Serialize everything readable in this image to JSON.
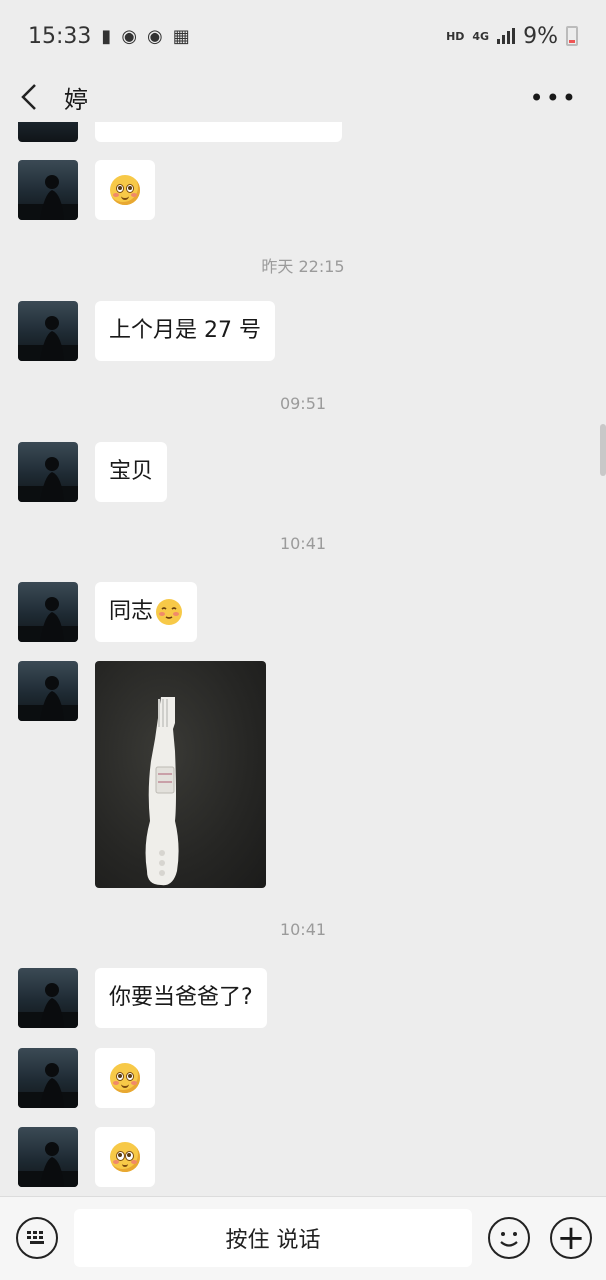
{
  "status_bar": {
    "time": "15:33",
    "network": "HD",
    "signal_label": "4G",
    "battery": "9%"
  },
  "header": {
    "contact_name": "婷",
    "back_icon": "chevron-left-icon",
    "more_icon": "more-dots-icon"
  },
  "messages": {
    "time_1": "昨天 22:15",
    "msg_1": "上个月是 27 号",
    "time_2": "09:51",
    "msg_2": "宝贝",
    "time_3": "10:41",
    "msg_3": "同志",
    "time_4": "10:41",
    "msg_4": "你要当爸爸了?"
  },
  "input_bar": {
    "voice_label": "按住 说话",
    "keyboard_icon": "keyboard-icon",
    "emoji_icon": "smiley-icon",
    "plus_icon": "plus-icon"
  },
  "colors": {
    "background": "#ededed",
    "bubble": "#ffffff",
    "time_text": "#9b9b9b"
  }
}
